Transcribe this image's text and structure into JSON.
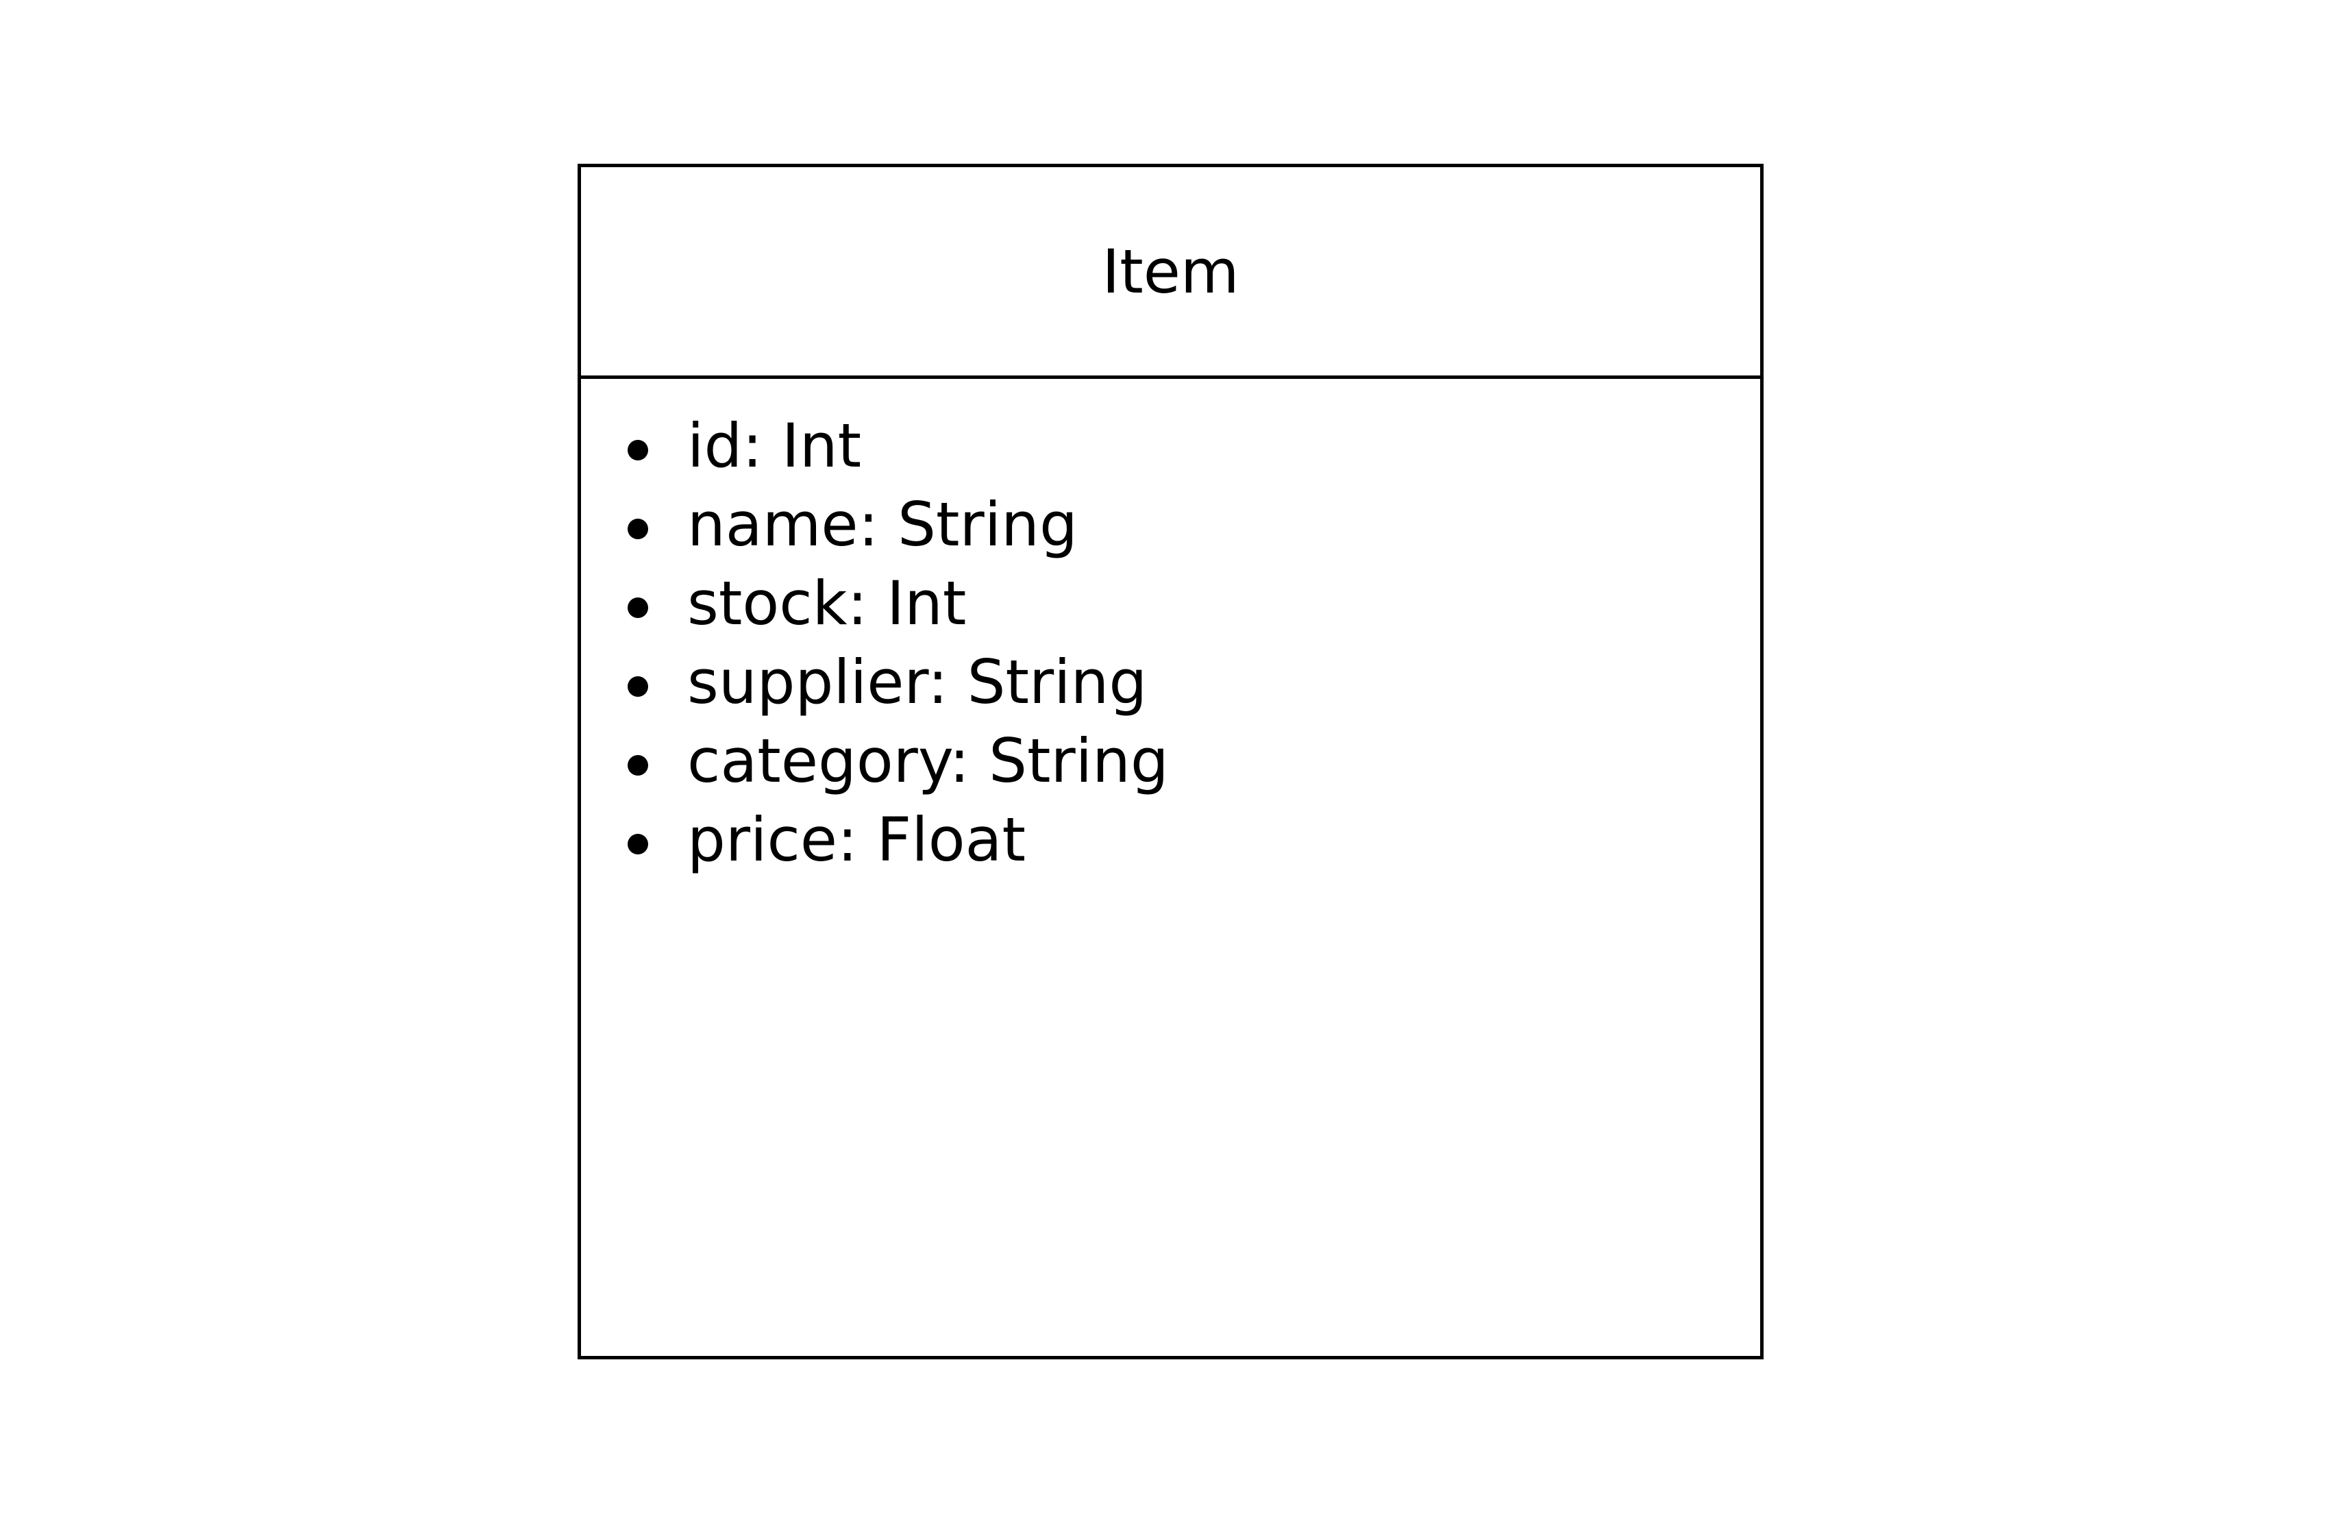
{
  "class_box": {
    "name": "Item",
    "attributes": [
      {
        "text": "id: Int"
      },
      {
        "text": "name: String"
      },
      {
        "text": "stock: Int"
      },
      {
        "text": "supplier: String"
      },
      {
        "text": "category: String"
      },
      {
        "text": "price: Float"
      }
    ]
  }
}
